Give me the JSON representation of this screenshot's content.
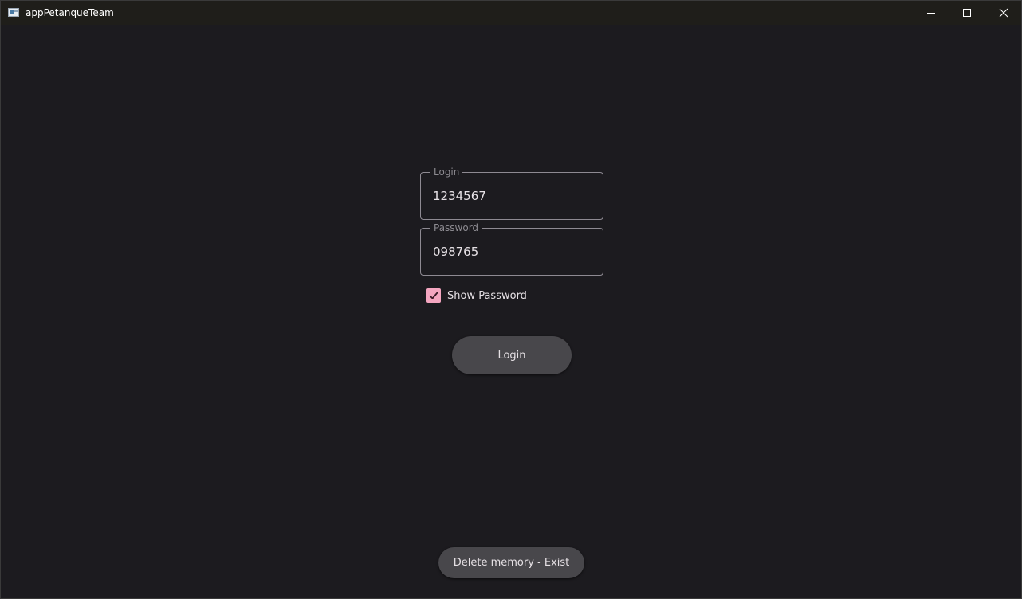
{
  "window": {
    "title": "appPetanqueTeam",
    "icon": "app-window-icon",
    "controls": {
      "minimize_icon": "minimize-icon",
      "maximize_icon": "maximize-icon",
      "close_icon": "close-icon"
    }
  },
  "form": {
    "login": {
      "label": "Login",
      "value": "1234567"
    },
    "password": {
      "label": "Password",
      "value": "098765"
    },
    "show_password": {
      "label": "Show Password",
      "checked": true,
      "icon": "check-icon"
    },
    "login_button": "Login"
  },
  "footer": {
    "delete_button": "Delete memory - Exist"
  },
  "colors": {
    "background": "#1c1b1f",
    "titlebar": "#1f1e1a",
    "accent": "#f4a6c0",
    "button": "#48474b",
    "text": "#e6e1e5",
    "outline": "#8e8a92"
  }
}
